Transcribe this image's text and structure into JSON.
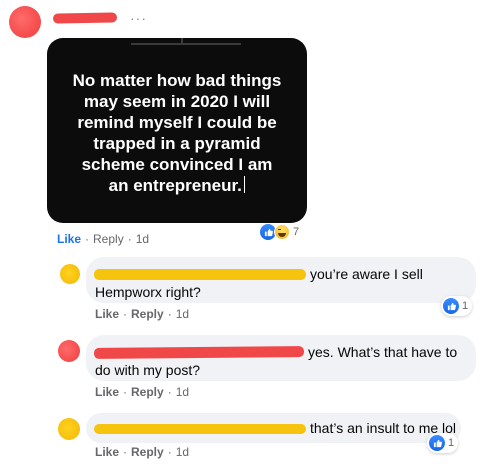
{
  "post": {
    "meme_text": "No matter how bad things\nmay seem in 2020 I will\nremind myself I could be\ntrapped in a pyramid\nscheme convinced I am\nan entrepreneur.",
    "more_label": "···",
    "actions": {
      "like": "Like",
      "sep": "·",
      "reply": "Reply",
      "time": "1d"
    },
    "reaction_count": "7"
  },
  "comments": [
    {
      "text_line1": "you’re aware I sell",
      "text_line2": "Hempworx right?",
      "actions": {
        "like": "Like",
        "sep": "·",
        "reply": "Reply",
        "time": "1d"
      },
      "reaction_count": "1"
    },
    {
      "text_line1": "yes. What’s that have to",
      "text_line2": "do with my post?",
      "actions": {
        "like": "Like",
        "sep": "·",
        "reply": "Reply",
        "time": "1d"
      }
    },
    {
      "text_line1": "that’s an insult to me lol",
      "actions": {
        "like": "Like",
        "sep": "·",
        "reply": "Reply",
        "time": "1d"
      },
      "reaction_count": "1"
    }
  ],
  "colors": {
    "redaction_red": "#f04848",
    "redaction_yellow": "#f6c30f",
    "fb_blue": "#1b74e4"
  },
  "icons": [
    "like-icon",
    "haha-icon",
    "more-icon"
  ]
}
